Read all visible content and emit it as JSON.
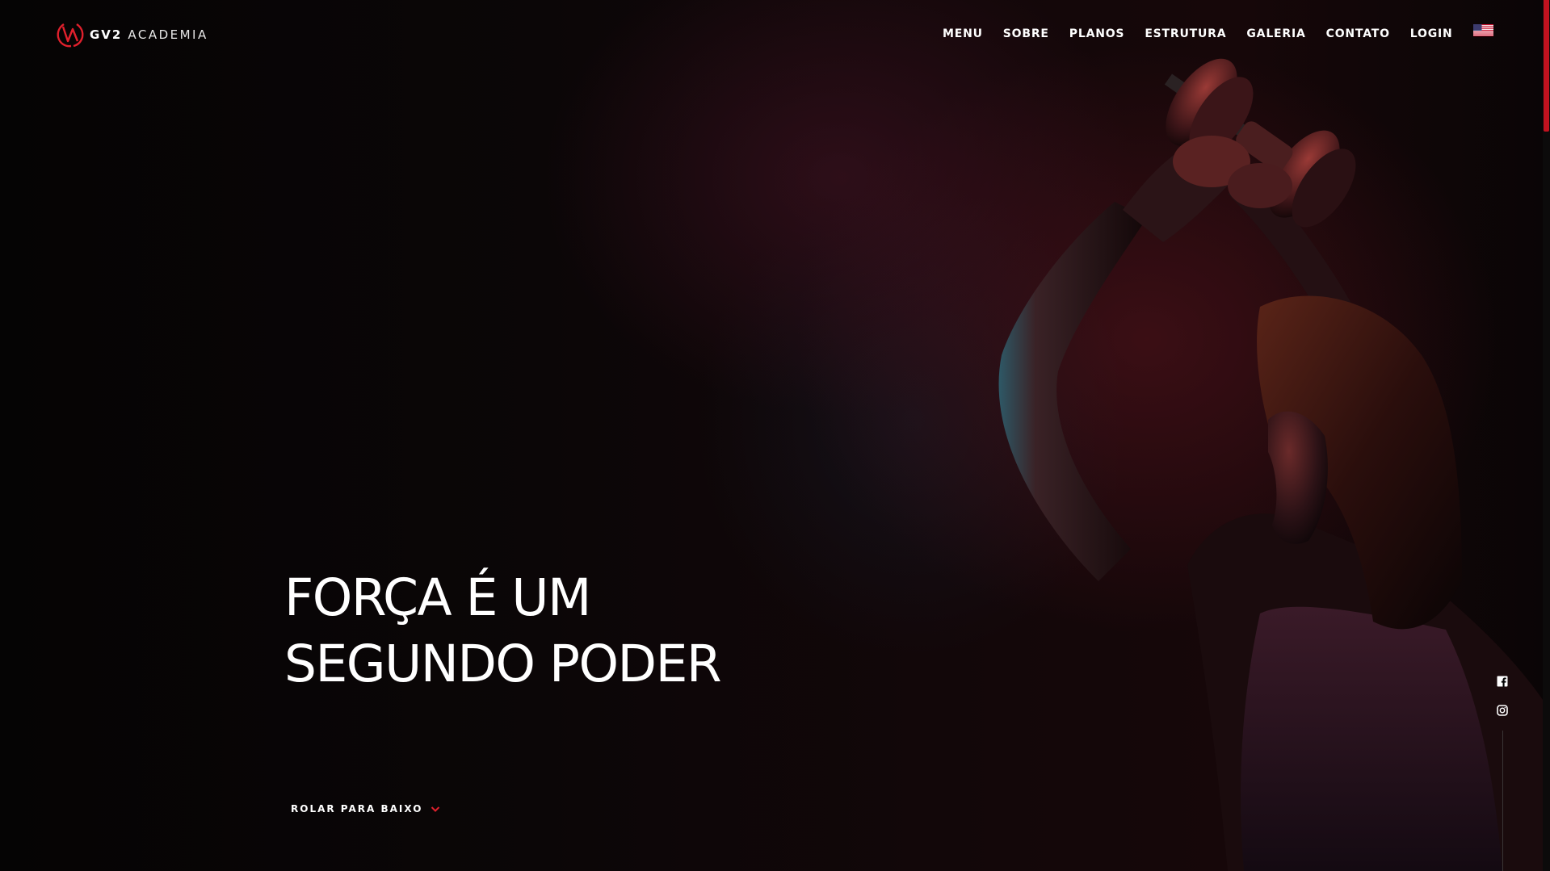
{
  "header": {
    "logo": {
      "bold": "GV2",
      "light": "ACADEMIA",
      "icon": "gv2-logo-icon"
    },
    "nav": [
      {
        "label": "MENU"
      },
      {
        "label": "SOBRE"
      },
      {
        "label": "PLANOS"
      },
      {
        "label": "ESTRUTURA"
      },
      {
        "label": "GALERIA"
      },
      {
        "label": "CONTATO"
      },
      {
        "label": "LOGIN"
      }
    ],
    "language_icon": "us-flag-icon"
  },
  "hero": {
    "headline_line1": "FORÇA É UM",
    "headline_line2": "SEGUNDO PODER",
    "scroll_label": "ROLAR PARA BAIXO"
  },
  "social": {
    "icons": [
      "facebook-icon",
      "instagram-icon"
    ]
  },
  "colors": {
    "accent": "#c1121f",
    "background": "#0a0607",
    "text": "#ffffff"
  }
}
